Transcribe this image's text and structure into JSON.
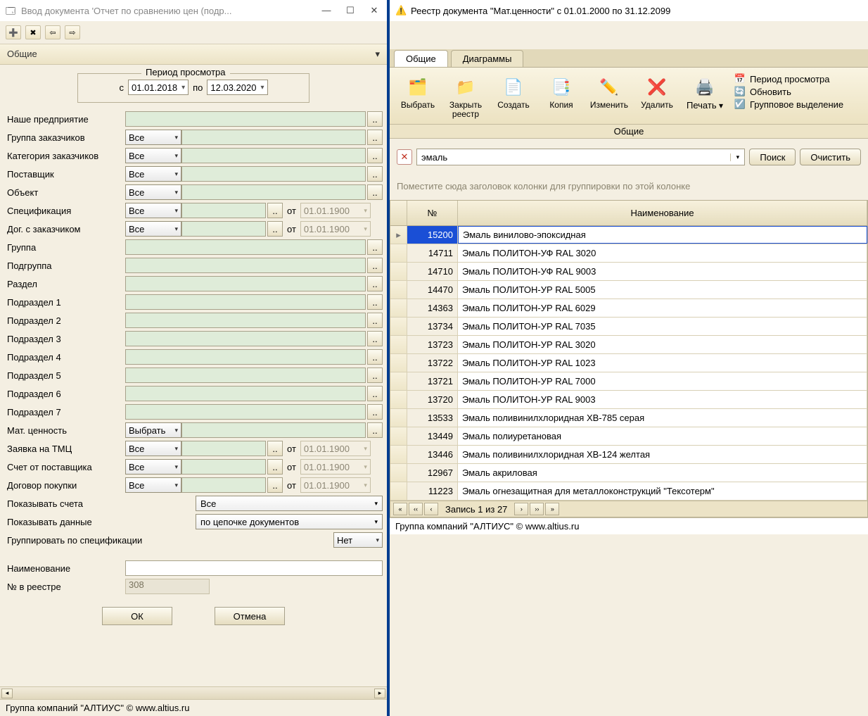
{
  "left": {
    "title": "Ввод документа 'Отчет по сравнению цен (подр...",
    "section": "Общие",
    "period": {
      "legend": "Период просмотра",
      "from_lbl": "с",
      "from": "01.01.2018",
      "to_lbl": "по",
      "to": "12.03.2020"
    },
    "option_all": "Все",
    "option_select": "Выбрать",
    "ot": "от",
    "dis_date": "01.01.1900",
    "labels": {
      "enterprise": "Наше предприятие",
      "cust_group": "Группа заказчиков",
      "cust_cat": "Категория заказчиков",
      "supplier": "Поставщик",
      "object": "Объект",
      "spec": "Спецификация",
      "cust_contract": "Дог. с заказчиком",
      "group": "Группа",
      "subgroup": "Подгруппа",
      "section": "Раздел",
      "sub1": "Подраздел 1",
      "sub2": "Подраздел 2",
      "sub3": "Подраздел 3",
      "sub4": "Подраздел 4",
      "sub5": "Подраздел 5",
      "sub6": "Подраздел 6",
      "sub7": "Подраздел 7",
      "mat": "Мат. ценность",
      "tmc": "Заявка на ТМЦ",
      "invoice": "Счет от поставщика",
      "purchase": "Договор покупки",
      "show_acc": "Показывать счета",
      "show_data": "Показывать данные",
      "group_spec": "Группировать по спецификации",
      "name": "Наименование",
      "regno": "№ в реестре"
    },
    "show_acc_val": "Все",
    "show_data_val": "по цепочке документов",
    "group_spec_val": "Нет",
    "regno_val": "308",
    "ok": "ОК",
    "cancel": "Отмена",
    "footer": "Группа компаний \"АЛТИУС\" © www.altius.ru"
  },
  "right": {
    "title": "Реестр документа \"Мат.ценности\" с 01.01.2000 по 31.12.2099",
    "tabs": {
      "common": "Общие",
      "diag": "Диаграммы"
    },
    "ribbon": {
      "select": "Выбрать",
      "close": "Закрыть реестр",
      "create": "Создать",
      "copy": "Копия",
      "edit": "Изменить",
      "delete": "Удалить",
      "print": "Печать",
      "period": "Период просмотра",
      "refresh": "Обновить",
      "groupsel": "Групповое выделение",
      "caption": "Общие"
    },
    "search": {
      "value": "эмаль",
      "find": "Поиск",
      "clear": "Очистить"
    },
    "grouphint": "Поместите сюда заголовок колонки для группировки по этой колонке",
    "cols": {
      "no": "№",
      "name": "Наименование"
    },
    "rows": [
      {
        "no": "15200",
        "name": "Эмаль винилово-эпоксидная",
        "sel": true
      },
      {
        "no": "14711",
        "name": "Эмаль ПОЛИТОН-УФ RAL 3020"
      },
      {
        "no": "14710",
        "name": "Эмаль ПОЛИТОН-УФ RAL 9003"
      },
      {
        "no": "14470",
        "name": "Эмаль ПОЛИТОН-УР RAL 5005"
      },
      {
        "no": "14363",
        "name": "Эмаль ПОЛИТОН-УР RAL 6029"
      },
      {
        "no": "13734",
        "name": "Эмаль ПОЛИТОН-УР RAL 7035"
      },
      {
        "no": "13723",
        "name": "Эмаль ПОЛИТОН-УР RAL 3020"
      },
      {
        "no": "13722",
        "name": "Эмаль ПОЛИТОН-УР RAL 1023"
      },
      {
        "no": "13721",
        "name": "Эмаль ПОЛИТОН-УР RAL 7000"
      },
      {
        "no": "13720",
        "name": "Эмаль ПОЛИТОН-УР RAL 9003"
      },
      {
        "no": "13533",
        "name": "Эмаль поливинилхлоридная ХВ-785 серая"
      },
      {
        "no": "13449",
        "name": "Эмаль полиуретановая"
      },
      {
        "no": "13446",
        "name": "Эмаль поливинилхлоридная ХВ-124 желтая"
      },
      {
        "no": "12967",
        "name": "Эмаль акриловая"
      },
      {
        "no": "11223",
        "name": "Эмаль огнезащитная для металлоконструкций \"Тексотерм\""
      }
    ],
    "nav": "Запись 1 из 27",
    "footer": "Группа компаний \"АЛТИУС\" © www.altius.ru"
  }
}
